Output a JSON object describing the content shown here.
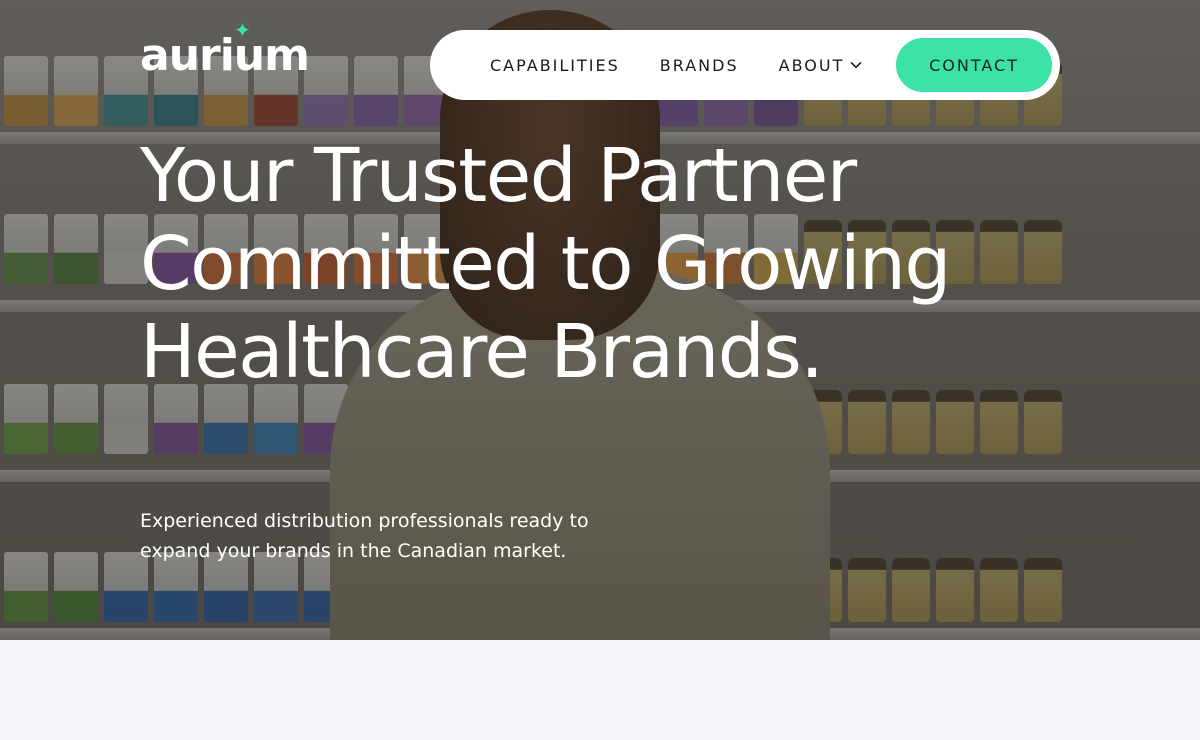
{
  "brand": {
    "logo_text": "aurium",
    "logo_accent": "✦",
    "accent_color": "#3ce2a6"
  },
  "nav": {
    "items": [
      {
        "label": "CAPABILITIES"
      },
      {
        "label": "BRANDS"
      },
      {
        "label": "ABOUT",
        "has_dropdown": true,
        "icon": "chevron-down-icon"
      }
    ],
    "cta_label": "CONTACT"
  },
  "hero": {
    "headline": "Your Trusted Partner Committed to Growing Healthcare Brands.",
    "subtext": "Experienced distribution professionals ready to expand your brands in the Canadian market."
  }
}
